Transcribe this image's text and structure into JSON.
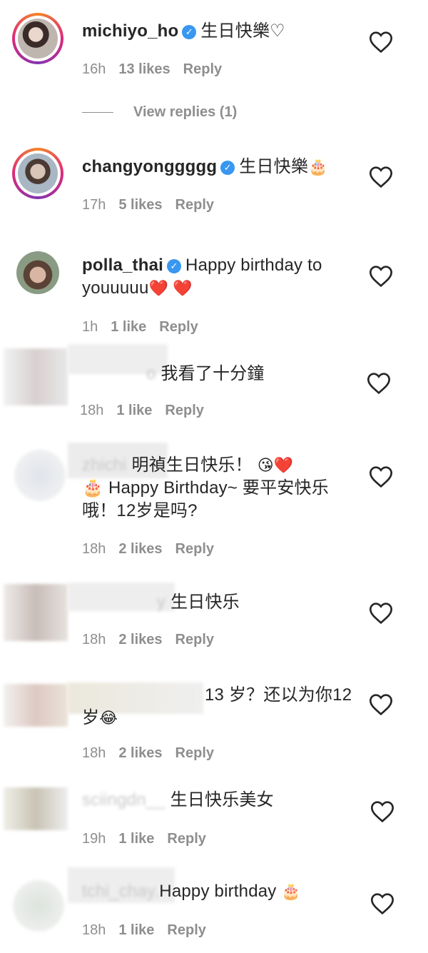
{
  "comments": [
    {
      "username": "michiyo_ho",
      "verified": true,
      "text": "生日快樂",
      "emoji": "♡",
      "time": "16h",
      "likes": "13 likes",
      "reply": "Reply",
      "view_replies": "View replies (1)"
    },
    {
      "username": "changyonggggg",
      "verified": true,
      "text": "生日快樂",
      "emoji": "🎂",
      "time": "17h",
      "likes": "5 likes",
      "reply": "Reply"
    },
    {
      "username": "polla_thai",
      "verified": true,
      "text": "Happy birthday to youuuuu",
      "emoji": "❤️ ❤️",
      "time": "1h",
      "likes": "1 like",
      "reply": "Reply"
    },
    {
      "username": "o",
      "text": "我看了十分鐘",
      "time": "18h",
      "likes": "1 like",
      "reply": "Reply"
    },
    {
      "username": "zhichi",
      "text": "明禎生日快乐！",
      "emoji": "😘❤️",
      "text2": "🎂 Happy Birthday~ 要平安快乐哦！12岁是吗?",
      "time": "18h",
      "likes": "2 likes",
      "reply": "Reply"
    },
    {
      "username": "y",
      "text": "生日快乐",
      "time": "18h",
      "likes": "2 likes",
      "reply": "Reply"
    },
    {
      "username": "",
      "text": "13 岁？还以为你12岁",
      "emoji": "😂",
      "time": "18h",
      "likes": "2 likes",
      "reply": "Reply"
    },
    {
      "username": "sciingdn__",
      "text": "生日快乐美女",
      "time": "19h",
      "likes": "1 like",
      "reply": "Reply"
    },
    {
      "username": "tchi_chay.",
      "text": "Happy birthday",
      "emoji": "🎂",
      "time": "18h",
      "likes": "1 like",
      "reply": "Reply"
    }
  ]
}
